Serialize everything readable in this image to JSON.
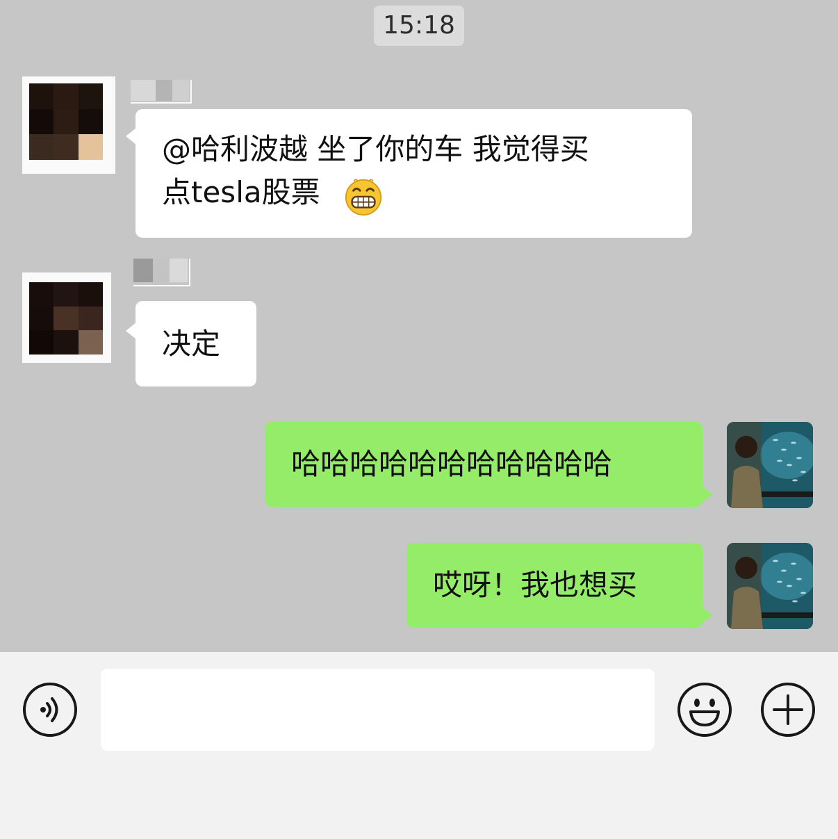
{
  "timestamp": "15:18",
  "messages": [
    {
      "side": "left",
      "text": "@哈利波越 坐了你的车 我觉得买\n点tesla股票",
      "emoji": "grinning-face-emoji"
    },
    {
      "side": "left",
      "text": "决定"
    },
    {
      "side": "right",
      "text": "哈哈哈哈哈哈哈哈哈哈哈"
    },
    {
      "side": "right",
      "text": "哎呀！我也想买"
    }
  ],
  "input_bar": {
    "value": "",
    "voice_icon": "voice-icon",
    "emoji_icon": "emoji-icon",
    "more_icon": "plus-icon"
  },
  "colors": {
    "chat_background": "#c6c6c6",
    "sent_bubble": "#95ec69",
    "received_bubble": "#ffffff",
    "input_bar_background": "#f2f2f2"
  }
}
